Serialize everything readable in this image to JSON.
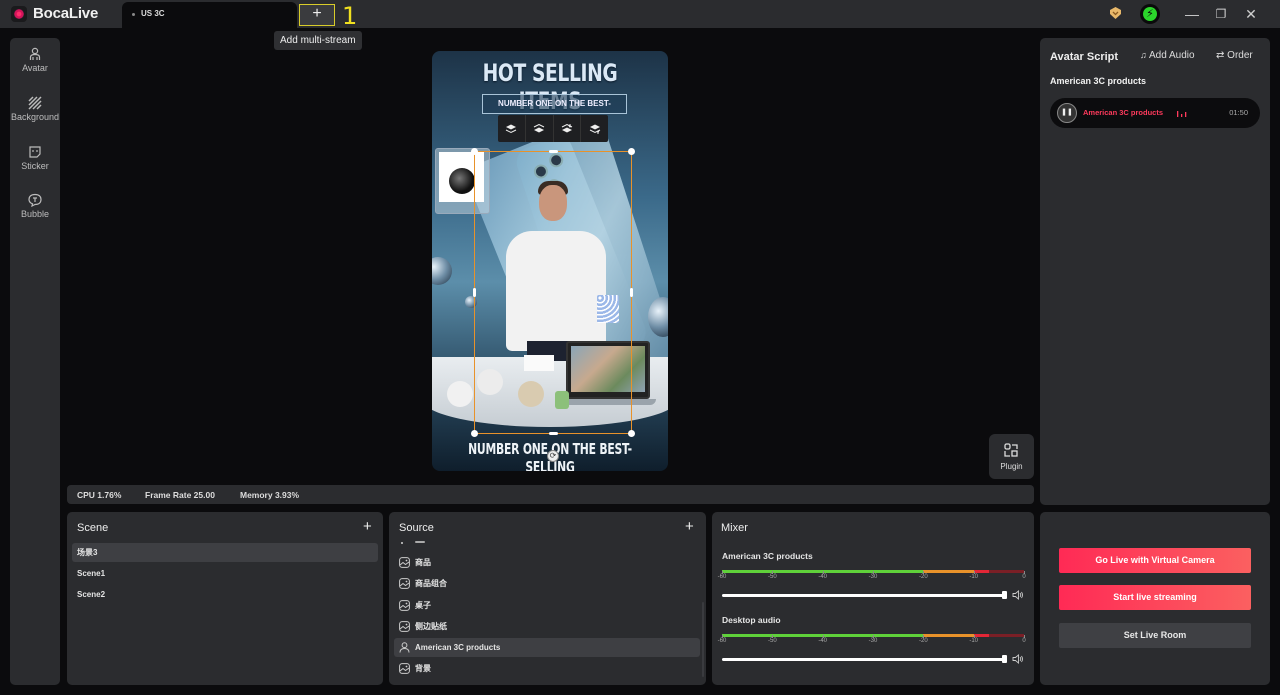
{
  "app": {
    "name": "BocaLive",
    "tab_label": "US 3C",
    "add_tab_symbol": "+",
    "annotation_marker": "1",
    "tooltip": "Add multi-stream",
    "window_controls": {
      "minimize": "—",
      "restore": "❐",
      "close": "✕"
    }
  },
  "sidebar": {
    "items": [
      {
        "label": "Avatar",
        "icon": "avatar-icon"
      },
      {
        "label": "Background",
        "icon": "background-icon"
      },
      {
        "label": "Sticker",
        "icon": "sticker-icon"
      },
      {
        "label": "Bubble",
        "icon": "bubble-icon"
      }
    ]
  },
  "preview": {
    "title": "HOT SELLING ITEMS",
    "subtitle": "NUMBER ONE ON THE BEST-SELLING",
    "bottom_text": "NUMBER ONE ON THE BEST-SELLING",
    "layer_toolbar": [
      "bring-forward",
      "send-backward",
      "send-to-back",
      "bring-to-front"
    ],
    "selection_color": "#e8922a"
  },
  "plugin": {
    "label": "Plugin"
  },
  "stats": {
    "cpu": "CPU 1.76%",
    "frame_rate": "Frame Rate 25.00",
    "memory": "Memory 3.93%"
  },
  "avatar_script": {
    "title": "Avatar Script",
    "add_audio": "Add Audio",
    "order": "Order",
    "script_name": "American 3C products",
    "audio": {
      "name": "American 3C products",
      "duration": "01:50",
      "state": "playing",
      "accent": "#ff3a5c"
    }
  },
  "scene": {
    "title": "Scene",
    "add": "+",
    "items": [
      {
        "label": "场景3",
        "active": true
      },
      {
        "label": "Scene1",
        "active": false
      },
      {
        "label": "Scene2",
        "active": false
      }
    ]
  },
  "source": {
    "title": "Source",
    "add": "+",
    "items": [
      {
        "label": "商品",
        "icon": "image-icon",
        "active": false
      },
      {
        "label": "商品组合",
        "icon": "image-icon",
        "active": false
      },
      {
        "label": "桌子",
        "icon": "image-icon",
        "active": false
      },
      {
        "label": "侧边贴纸",
        "icon": "image-icon",
        "active": false
      },
      {
        "label": "American 3C products",
        "icon": "person-icon",
        "active": true
      },
      {
        "label": "背景",
        "icon": "image-icon",
        "active": false
      }
    ]
  },
  "mixer": {
    "title": "Mixer",
    "scale": [
      "-60",
      "-50",
      "-40",
      "-30",
      "-20",
      "-10",
      "0"
    ],
    "channels": [
      {
        "label": "American 3C products",
        "volume_percent": 100
      },
      {
        "label": "Desktop audio",
        "volume_percent": 100
      }
    ],
    "meter_colors": {
      "green": "#5fd13a",
      "orange": "#e8922a",
      "red": "#e32636",
      "dark_red": "#7a1f26"
    }
  },
  "live": {
    "virtual_camera": "Go Live with Virtual Camera",
    "start_streaming": "Start live streaming",
    "set_room": "Set Live Room"
  }
}
